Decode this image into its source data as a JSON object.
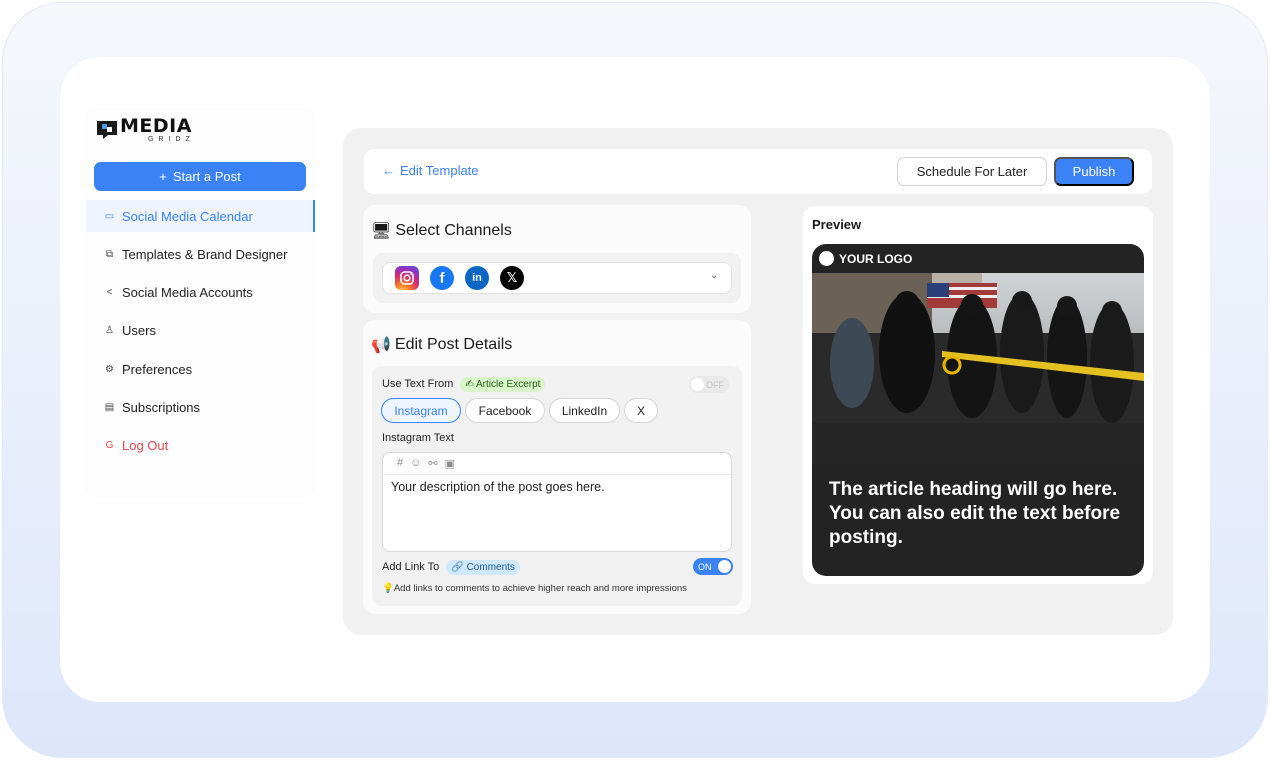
{
  "brand": {
    "title": "MEDIA",
    "subtitle": "GRIDZ"
  },
  "sidebar": {
    "start_button": "Start a Post",
    "items": [
      {
        "label": "Social Media Calendar",
        "icon": "calendar-icon",
        "active": true
      },
      {
        "label": "Templates & Brand Designer",
        "icon": "template-icon"
      },
      {
        "label": "Social Media Accounts",
        "icon": "share-icon"
      },
      {
        "label": "Users",
        "icon": "users-icon"
      },
      {
        "label": "Preferences",
        "icon": "gear-icon"
      },
      {
        "label": "Subscriptions",
        "icon": "card-icon"
      },
      {
        "label": "Log Out",
        "icon": "logout-icon"
      }
    ]
  },
  "topbar": {
    "back_label": "Edit Template",
    "schedule_label": "Schedule For Later",
    "publish_label": "Publish"
  },
  "channels": {
    "title": "Select Channels",
    "selected": [
      "Instagram",
      "Facebook",
      "LinkedIn",
      "X"
    ]
  },
  "post": {
    "title": "Edit Post Details",
    "use_text_label": "Use Text From",
    "use_text_tag": "✍ Article Excerpt",
    "use_text_toggle": "OFF",
    "tabs": [
      "Instagram",
      "Facebook",
      "LinkedIn",
      "X"
    ],
    "active_tab": "Instagram",
    "text_label": "Instagram Text",
    "text_value": "Your description of the post goes here.",
    "add_link_label": "Add Link To",
    "add_link_tag": "🔗 Comments",
    "add_link_toggle": "ON",
    "hint": "💡Add links to comments to achieve higher reach and more impressions"
  },
  "preview": {
    "title": "Preview",
    "logo_text": "YOUR LOGO",
    "heading": "The article heading will go here. You can also edit the text before posting."
  },
  "colors": {
    "accent": "#3b82f6",
    "danger": "#e5484d"
  }
}
